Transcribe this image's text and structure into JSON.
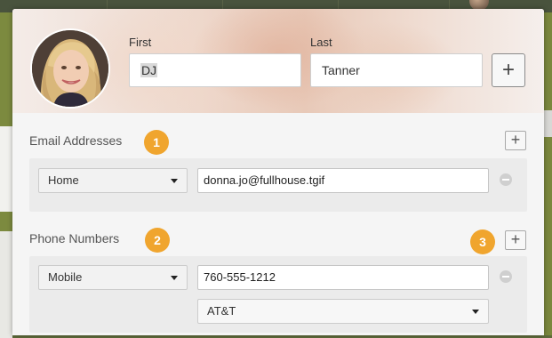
{
  "header": {
    "first_label": "First",
    "first_value": "DJ",
    "last_label": "Last",
    "last_value": "Tanner",
    "add_icon": "+"
  },
  "email": {
    "title": "Email Addresses",
    "badge": "1",
    "type": "Home",
    "value": "donna.jo@fullhouse.tgif",
    "add_icon": "+"
  },
  "phone": {
    "title": "Phone Numbers",
    "badge": "2",
    "add_badge": "3",
    "type": "Mobile",
    "value": "760-555-1212",
    "carrier": "AT&T",
    "add_icon": "+"
  },
  "colors": {
    "badge": "#f0a52e",
    "background_app": "#7c8a3f"
  }
}
